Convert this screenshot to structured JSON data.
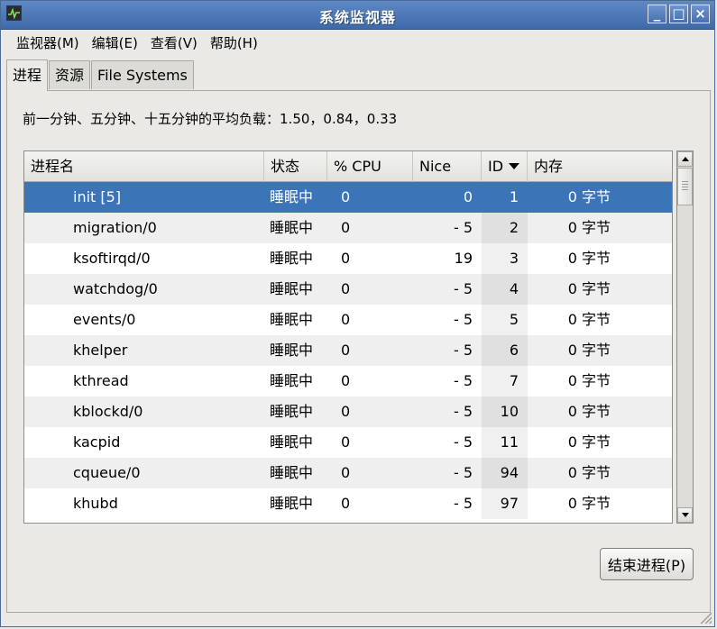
{
  "window": {
    "title": "系统监视器",
    "controls": {
      "minimize": "_",
      "maximize": "□",
      "close": "×"
    }
  },
  "menu": [
    "监视器(M)",
    "编辑(E)",
    "查看(V)",
    "帮助(H)"
  ],
  "tabs": [
    {
      "label": "进程",
      "active": true
    },
    {
      "label": "资源",
      "active": false
    },
    {
      "label": "File Systems",
      "active": false
    }
  ],
  "load_average": "前一分钟、五分钟、十五分钟的平均负载：1.50，0.84，0.33",
  "table": {
    "columns": [
      "进程名",
      "状态",
      "% CPU",
      "Nice",
      "ID",
      "内存"
    ],
    "sort_column": "ID",
    "rows": [
      {
        "name": "init [5]",
        "state": "睡眠中",
        "cpu": "0",
        "nice": "0",
        "id": "1",
        "mem": "0 字节",
        "selected": true
      },
      {
        "name": "migration/0",
        "state": "睡眠中",
        "cpu": "0",
        "nice": "- 5",
        "id": "2",
        "mem": "0 字节"
      },
      {
        "name": "ksoftirqd/0",
        "state": "睡眠中",
        "cpu": "0",
        "nice": "19",
        "id": "3",
        "mem": "0 字节"
      },
      {
        "name": "watchdog/0",
        "state": "睡眠中",
        "cpu": "0",
        "nice": "- 5",
        "id": "4",
        "mem": "0 字节"
      },
      {
        "name": "events/0",
        "state": "睡眠中",
        "cpu": "0",
        "nice": "- 5",
        "id": "5",
        "mem": "0 字节"
      },
      {
        "name": "khelper",
        "state": "睡眠中",
        "cpu": "0",
        "nice": "- 5",
        "id": "6",
        "mem": "0 字节"
      },
      {
        "name": "kthread",
        "state": "睡眠中",
        "cpu": "0",
        "nice": "- 5",
        "id": "7",
        "mem": "0 字节"
      },
      {
        "name": "kblockd/0",
        "state": "睡眠中",
        "cpu": "0",
        "nice": "- 5",
        "id": "10",
        "mem": "0 字节"
      },
      {
        "name": "kacpid",
        "state": "睡眠中",
        "cpu": "0",
        "nice": "- 5",
        "id": "11",
        "mem": "0 字节"
      },
      {
        "name": "cqueue/0",
        "state": "睡眠中",
        "cpu": "0",
        "nice": "- 5",
        "id": "94",
        "mem": "0 字节"
      },
      {
        "name": "khubd",
        "state": "睡眠中",
        "cpu": "0",
        "nice": "- 5",
        "id": "97",
        "mem": "0 字节"
      }
    ]
  },
  "end_process_button": "结束进程(P)",
  "colors": {
    "titlebar": "#4f79b8",
    "selection": "#3c74b8",
    "background": "#eae9e5"
  }
}
